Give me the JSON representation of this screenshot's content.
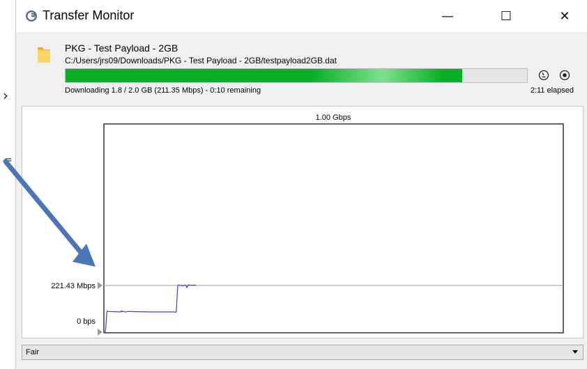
{
  "window": {
    "title": "Transfer Monitor",
    "minimize_glyph": "—",
    "maximize_glyph": "☐",
    "close_glyph": "✕"
  },
  "transfer": {
    "name": "PKG - Test Payload - 2GB",
    "path": "C:/Users/jrs09/Downloads/PKG - Test Payload - 2GB/testpayload2GB.dat",
    "progress_fraction": 0.86,
    "status": "Downloading 1.8 / 2.0 GB (211.35 Mbps) - 0:10 remaining",
    "elapsed": "2:11 elapsed"
  },
  "graph": {
    "top_label": "1.00 Gbps",
    "current_label": "221.43 Mbps",
    "zero_label": "0 bps"
  },
  "chart_data": {
    "type": "line",
    "x": [
      0,
      1,
      2,
      3,
      4,
      5,
      30,
      31,
      32,
      33,
      34,
      35,
      36,
      40,
      45,
      60,
      90,
      135,
      138,
      139,
      140,
      141,
      142,
      144,
      146,
      148,
      150,
      152,
      154,
      156,
      158,
      160,
      162,
      165,
      170,
      175,
      178
    ],
    "series": [
      {
        "values": [
          0,
          20,
          60,
          95,
          100,
          98,
          96,
          100,
          98,
          97,
          100,
          99,
          97,
          96,
          98,
          97,
          96,
          96,
          94,
          98,
          130,
          180,
          220,
          224,
          222,
          221,
          222,
          219,
          221,
          224,
          221,
          212,
          222,
          224,
          221,
          224,
          221
        ]
      }
    ],
    "ylim": [
      0,
      1000
    ],
    "y_ticks": [
      "0 bps",
      "221.43 Mbps",
      "1.00 Gbps"
    ],
    "grid": false
  },
  "footer": {
    "selected": "Fair"
  },
  "icons": {
    "app": "transfer-app-icon",
    "folder": "folder-icon",
    "limit": "speed-limit-icon",
    "record": "record-icon",
    "dropdown": "chevron-down-icon"
  },
  "colors": {
    "progress": "#06b025",
    "line": "#3b3bd6",
    "annotation_arrow": "#4a76b8"
  }
}
